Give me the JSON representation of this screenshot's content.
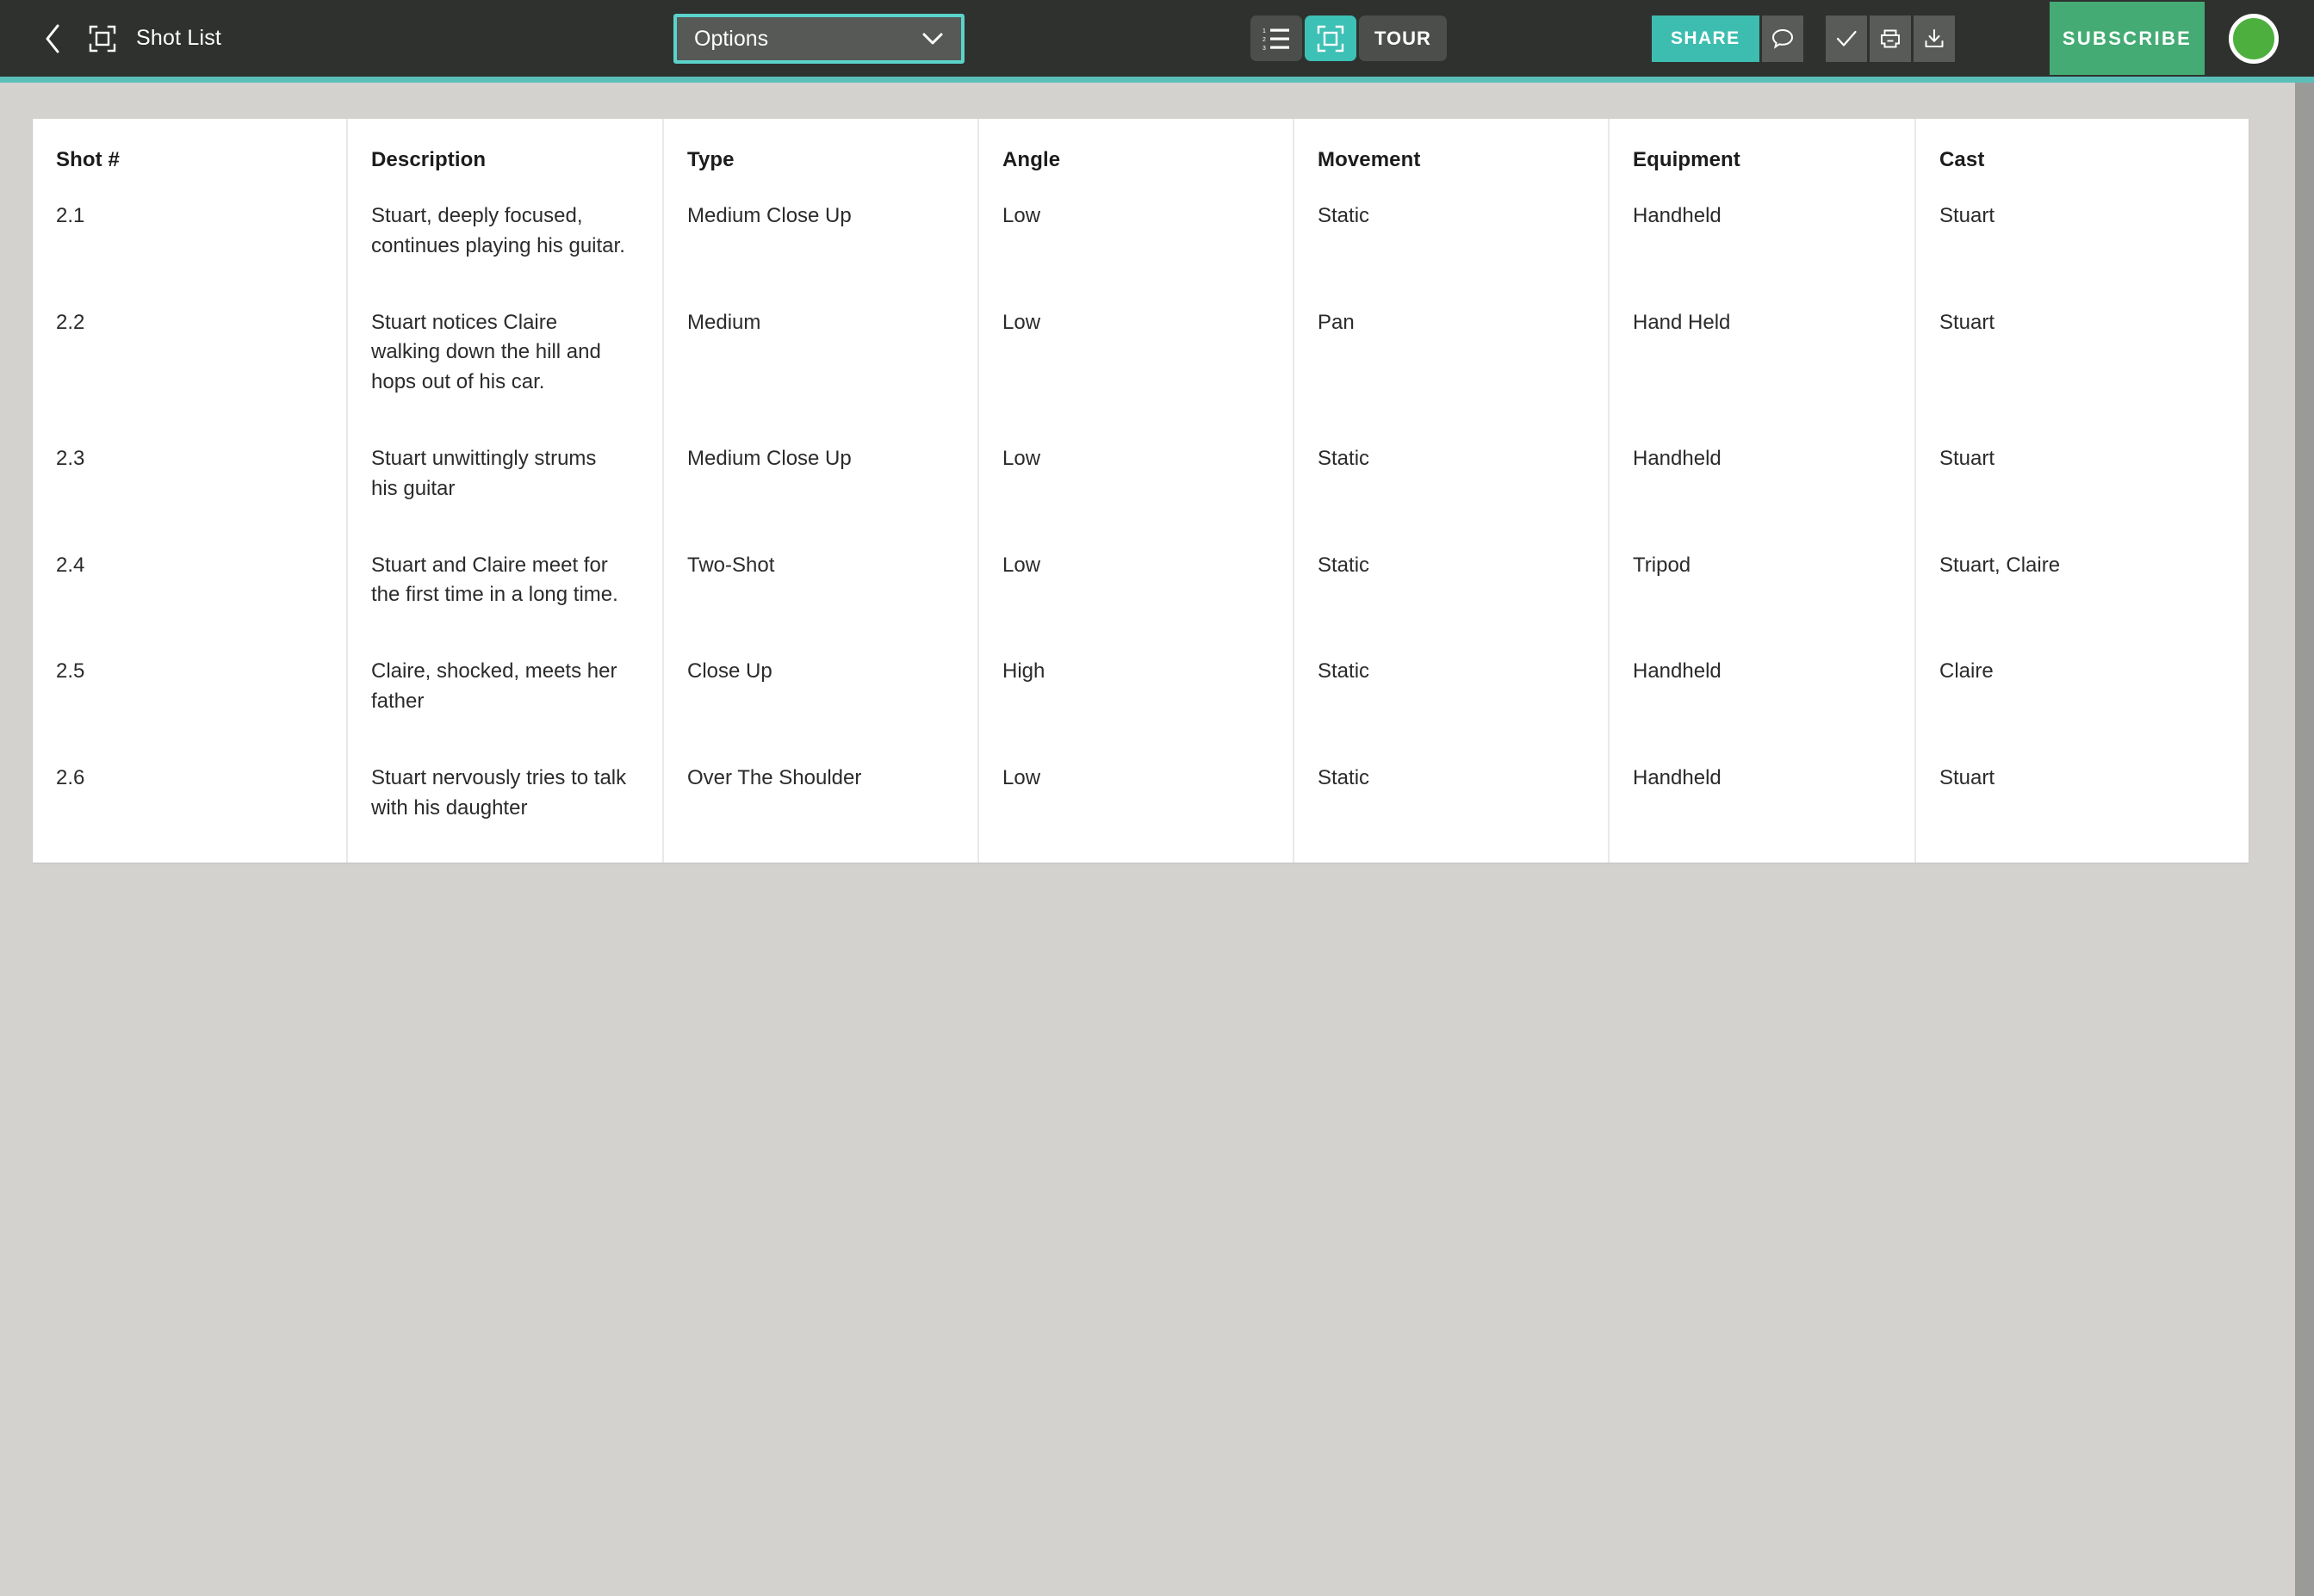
{
  "header": {
    "back_icon": "chevron-left-icon",
    "frame_icon": "frame-crop-icon",
    "title": "Shot List",
    "options_select": {
      "value": "Options",
      "chevron_icon": "chevron-down-icon"
    },
    "view_toggles": [
      {
        "name": "list-view",
        "icon": "numbered-list-icon",
        "active": false
      },
      {
        "name": "storyboard-view",
        "icon": "frame-crop-icon",
        "active": true
      }
    ],
    "tour_label": "TOUR",
    "share_label": "SHARE",
    "actions": [
      {
        "name": "comment",
        "icon": "comment-bubble-icon"
      },
      {
        "name": "approve",
        "icon": "checkmark-icon"
      },
      {
        "name": "print",
        "icon": "printer-icon"
      },
      {
        "name": "download",
        "icon": "download-icon"
      }
    ],
    "subscribe_label": "SUBSCRIBE",
    "avatar": "user-avatar"
  },
  "colors": {
    "toolbar_bg": "#2e312e",
    "accent_teal": "#5bbfb9",
    "active_teal": "#3dc0b5",
    "share_teal": "#3dbdb0",
    "subscribe_green": "#44ab74",
    "avatar_green": "#4caf3e",
    "page_bg": "#d3d2cf",
    "card_bg": "#ffffff",
    "grid_line": "#e9e9e9",
    "scrollbar": "#9a9a98"
  },
  "table": {
    "columns": [
      "Shot #",
      "Description",
      "Type",
      "Angle",
      "Movement",
      "Equipment",
      "Cast"
    ],
    "rows": [
      {
        "shot": "2.1",
        "description": "Stuart, deeply focused, continues playing his guitar.",
        "type": "Medium Close Up",
        "angle": "Low",
        "movement": "Static",
        "equipment": "Handheld",
        "cast": "Stuart"
      },
      {
        "shot": "2.2",
        "description": "Stuart notices Claire walking down the hill and hops out of his car.",
        "type": "Medium",
        "angle": "Low",
        "movement": "Pan",
        "equipment": "Hand Held",
        "cast": "Stuart"
      },
      {
        "shot": "2.3",
        "description": "Stuart unwittingly strums his guitar",
        "type": "Medium Close Up",
        "angle": "Low",
        "movement": "Static",
        "equipment": "Handheld",
        "cast": "Stuart"
      },
      {
        "shot": "2.4",
        "description": "Stuart and Claire meet for the first time in a long time.",
        "type": "Two-Shot",
        "angle": "Low",
        "movement": "Static",
        "equipment": "Tripod",
        "cast": "Stuart, Claire"
      },
      {
        "shot": "2.5",
        "description": "Claire, shocked, meets her father",
        "type": "Close Up",
        "angle": "High",
        "movement": "Static",
        "equipment": "Handheld",
        "cast": "Claire"
      },
      {
        "shot": "2.6",
        "description": "Stuart nervously tries to talk with his daughter",
        "type": "Over The Shoulder",
        "angle": "Low",
        "movement": "Static",
        "equipment": "Handheld",
        "cast": "Stuart"
      }
    ]
  }
}
